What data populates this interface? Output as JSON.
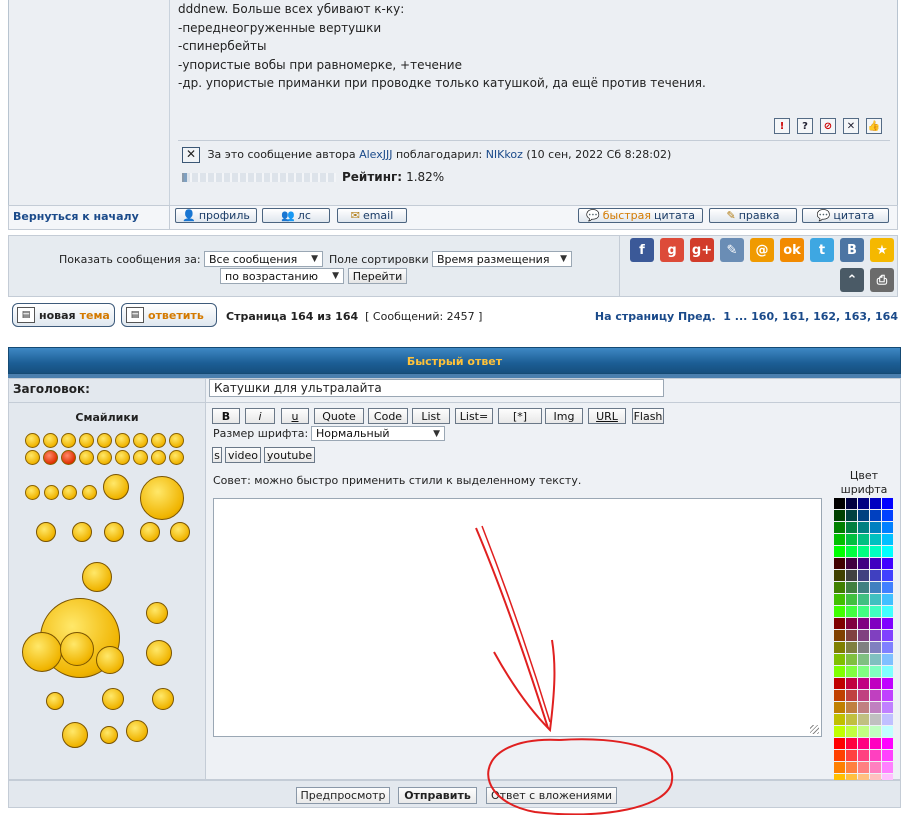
{
  "post": {
    "lines": [
      "dddnew. Больше всех убивают к-ку:",
      "-переднеогруженные вертушки",
      "-спинербейты",
      "-упористые вобы при равномерке, +течение",
      "-др. упористые приманки при проводке только катушкой, да ещё против течения."
    ],
    "report_icons": [
      "!",
      "?",
      "⊘",
      "✕",
      "👍"
    ],
    "thanks_prefix": "За это сообщение автора",
    "thanks_author": "AlexJJJ",
    "thanks_mid": "поблагодарил:",
    "thanks_user": "NIKkoz",
    "thanks_date": "(10 сен, 2022 Сб 8:28:02)",
    "rating_label": "Рейтинг:",
    "rating_value": "1.82%",
    "rating_fraction": 0.0182
  },
  "actions": {
    "back_to_top": "Вернуться к началу",
    "profile": "профиль",
    "pm": "лс",
    "email": "email",
    "quick_quote_a": "быстрая",
    "quick_quote_b": "цитата",
    "edit": "правка",
    "quote": "цитата"
  },
  "sortbar": {
    "show_label": "Показать сообщения за:",
    "show_value": "Все сообщения",
    "sort_label": "Поле сортировки",
    "sort_value": "Время размещения",
    "order_value": "по возрастанию",
    "go_button": "Перейти"
  },
  "social": {
    "items": [
      {
        "icon": "facebook-icon",
        "glyph": "f",
        "color": "#3b5998"
      },
      {
        "icon": "google-icon",
        "glyph": "g",
        "color": "#dd4b39"
      },
      {
        "icon": "google-plus-icon",
        "glyph": "g+",
        "color": "#d23c2a"
      },
      {
        "icon": "livejournal-icon",
        "glyph": "✎",
        "color": "#6a8db5"
      },
      {
        "icon": "mailru-icon",
        "glyph": "@",
        "color": "#f09a00"
      },
      {
        "icon": "odnoklassniki-icon",
        "glyph": "ok",
        "color": "#f28a00"
      },
      {
        "icon": "twitter-icon",
        "glyph": "t",
        "color": "#3ea7e2"
      },
      {
        "icon": "vkontakte-icon",
        "glyph": "B",
        "color": "#4c75a3"
      },
      {
        "icon": "favorite-star-icon",
        "glyph": "★",
        "color": "#f5b800"
      }
    ]
  },
  "nav": {
    "new_topic_a": "новая",
    "new_topic_b": "тема",
    "reply": "ответить",
    "page_info": "Страница 164 из 164",
    "post_count": "[ Сообщений: 2457 ]",
    "pager_label": "На страницу",
    "pager_prev": "Пред.",
    "pager_pages": "1 ... 160, 161, 162, 163, 164"
  },
  "quick_reply": {
    "title": "Быстрый ответ",
    "subject_label": "Заголовок:",
    "subject_value": "Катушки для ультралайта",
    "smilies_title": "Смайлики",
    "toolbar": [
      "B",
      "i",
      "u",
      "Quote",
      "Code",
      "List",
      "List=",
      "[*]",
      "Img",
      "URL",
      "Flash"
    ],
    "font_size_label": "Размер шрифта:",
    "font_size_value": "Нормальный",
    "toolbar2": [
      "s",
      "video",
      "youtube"
    ],
    "tip": "Совет: можно быстро применить стили к выделенному тексту.",
    "color_label": "Цвет шрифта",
    "preview": "Предпросмотр",
    "submit": "Отправить",
    "attach_reply": "Ответ с вложениями"
  },
  "annotation": {
    "color": "#e02020",
    "shape": "hand-drawn arrow pointing to attach button, circled"
  }
}
